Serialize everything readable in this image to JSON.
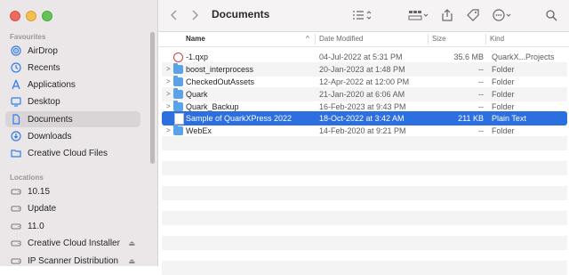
{
  "window": {
    "title": "Documents"
  },
  "sidebar": {
    "favourites_title": "Favourites",
    "favourites": [
      {
        "label": "AirDrop",
        "icon": "airdrop-icon"
      },
      {
        "label": "Recents",
        "icon": "clock-icon"
      },
      {
        "label": "Applications",
        "icon": "applications-icon"
      },
      {
        "label": "Desktop",
        "icon": "desktop-icon"
      },
      {
        "label": "Documents",
        "icon": "document-icon",
        "selected": true
      },
      {
        "label": "Downloads",
        "icon": "download-icon"
      },
      {
        "label": "Creative Cloud Files",
        "icon": "folder-icon"
      }
    ],
    "locations_title": "Locations",
    "locations": [
      {
        "label": "10.15",
        "icon": "disk-icon"
      },
      {
        "label": "Update",
        "icon": "disk-icon"
      },
      {
        "label": "11.0",
        "icon": "disk-icon"
      },
      {
        "label": "Creative Cloud Installer",
        "icon": "disk-icon",
        "eject": true
      },
      {
        "label": "IP Scanner Distribution",
        "icon": "disk-icon",
        "eject": true
      }
    ]
  },
  "toolbar": {
    "back": "back-chevron-icon",
    "forward": "forward-chevron-icon",
    "list_view": "list-view-icon",
    "group": "group-icon",
    "share": "share-icon",
    "tag": "tag-icon",
    "more": "ellipsis-icon",
    "search": "search-icon"
  },
  "columns": {
    "name": "Name",
    "date": "Date Modified",
    "size": "Size",
    "kind": "Kind"
  },
  "files": [
    {
      "name": "-1.qxp",
      "date": "04-Jul-2022 at 5:31 PM",
      "size": "35.6 MB",
      "kind": "QuarkX...Projects",
      "type": "qxp"
    },
    {
      "name": "boost_interprocess",
      "date": "20-Jan-2023 at 1:48 PM",
      "size": "--",
      "kind": "Folder",
      "type": "folder"
    },
    {
      "name": "CheckedOutAssets",
      "date": "12-Apr-2022 at 12:00 PM",
      "size": "--",
      "kind": "Folder",
      "type": "folder"
    },
    {
      "name": "Quark",
      "date": "21-Jan-2020 at 6:06 AM",
      "size": "--",
      "kind": "Folder",
      "type": "folder"
    },
    {
      "name": "Quark_Backup",
      "date": "16-Feb-2023 at 9:43 PM",
      "size": "--",
      "kind": "Folder",
      "type": "folder"
    },
    {
      "name": "Sample of QuarkXPress 2022",
      "date": "18-Oct-2022 at 3:42 AM",
      "size": "211 KB",
      "kind": "Plain Text",
      "type": "doc",
      "selected": true
    },
    {
      "name": "WebEx",
      "date": "14-Feb-2020 at 9:21 PM",
      "size": "--",
      "kind": "Folder",
      "type": "folder"
    }
  ]
}
